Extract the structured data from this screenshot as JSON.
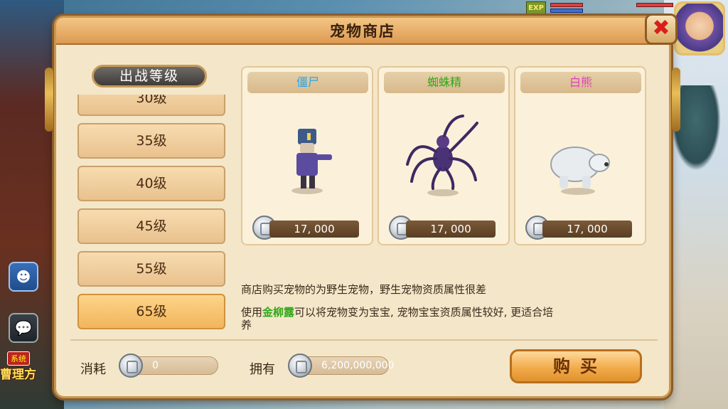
{
  "hud": {
    "exp_label": "EXP"
  },
  "shop": {
    "title": "宠物商店",
    "close_label": "✖"
  },
  "level_panel": {
    "header": "出战等级",
    "levels": [
      {
        "label": "30级",
        "selected": false
      },
      {
        "label": "35级",
        "selected": false
      },
      {
        "label": "40级",
        "selected": false
      },
      {
        "label": "45级",
        "selected": false
      },
      {
        "label": "55级",
        "selected": false
      },
      {
        "label": "65级",
        "selected": true
      }
    ]
  },
  "pets": [
    {
      "name": "僵尸",
      "name_color": "#2aa6e6",
      "price": "17, 000",
      "figure": "zombie"
    },
    {
      "name": "蜘蛛精",
      "name_color": "#2fa81a",
      "price": "17, 000",
      "figure": "spider"
    },
    {
      "name": "白熊",
      "name_color": "#e040c0",
      "price": "17, 000",
      "figure": "bear"
    }
  ],
  "description": {
    "line1": "商店购买宠物的为野生宠物，野生宠物资质属性很差",
    "line2_prefix": "使用",
    "line2_item": "金柳露",
    "line2_suffix": "可以将宠物变为宝宝, 宠物宝宝资质属性较好, 更适合培",
    "line3": "养"
  },
  "footer": {
    "cost_label": "消耗",
    "cost_value": "0",
    "own_label": "拥有",
    "own_value": "6,200,000,000",
    "buy_label": "购买"
  },
  "sidebar": {
    "system_tag": "系统",
    "system_text": "曹理方"
  }
}
